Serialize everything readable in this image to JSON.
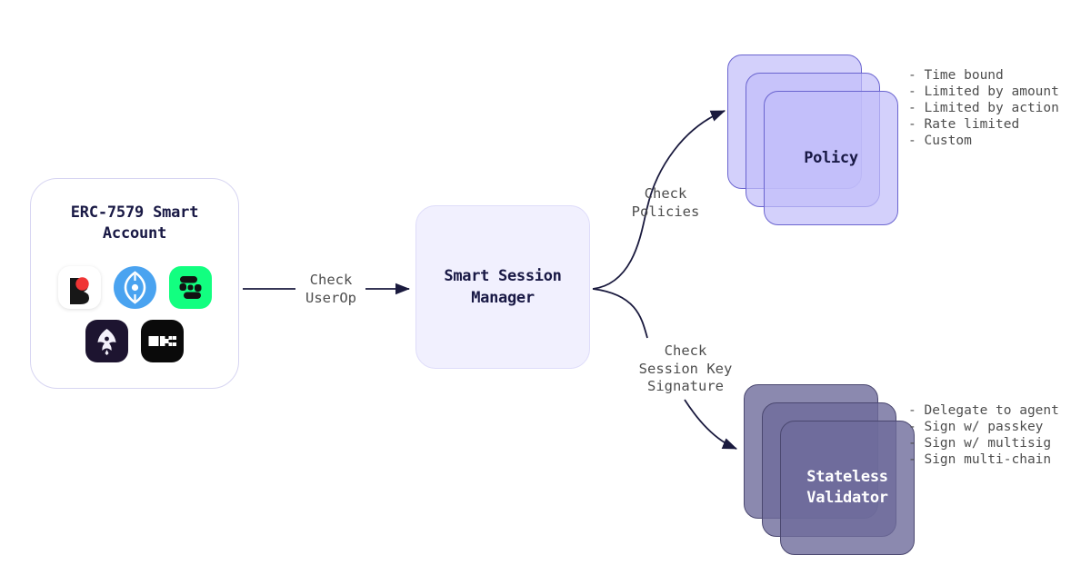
{
  "diagram": {
    "account": {
      "title": "ERC-7579 Smart\nAccount",
      "logos": [
        [
          {
            "name": "biconomy-logo",
            "label": "Biconomy"
          },
          {
            "name": "zerodev-logo",
            "label": "ZeroDev"
          },
          {
            "name": "safe-logo",
            "label": "Safe"
          }
        ],
        [
          {
            "name": "etherspot-logo",
            "label": "Etherspot"
          },
          {
            "name": "okx-logo",
            "label": "OKX"
          }
        ]
      ]
    },
    "manager": {
      "title": "Smart Session\nManager"
    },
    "policy": {
      "title": "Policy",
      "bullets": "- Time bound\n- Limited by amount\n- Limited by action\n- Rate limited\n- Custom"
    },
    "validator": {
      "title": "Stateless\nValidator",
      "bullets": "- Delegate to agent\n- Sign w/ passkey\n- Sign w/ multisig\n- Sign multi-chain"
    },
    "edges": {
      "check_userop": "Check\nUserOp",
      "check_policies": "Check\nPolicies",
      "check_signature": "Check\nSession Key\nSignature"
    }
  },
  "colors": {
    "background": "#ffffff",
    "text_dark": "#191945",
    "text_gray": "#4e4e4e",
    "policy_fill": "#c2befa",
    "policy_border": "#6a64cf",
    "validator_fill": "#6e6b9b",
    "validator_border": "#4b4870",
    "manager_fill": "#f1f0fe",
    "manager_border": "#dedcfa",
    "account_border": "#d7d5f2",
    "arrow": "#1a1a3e"
  }
}
